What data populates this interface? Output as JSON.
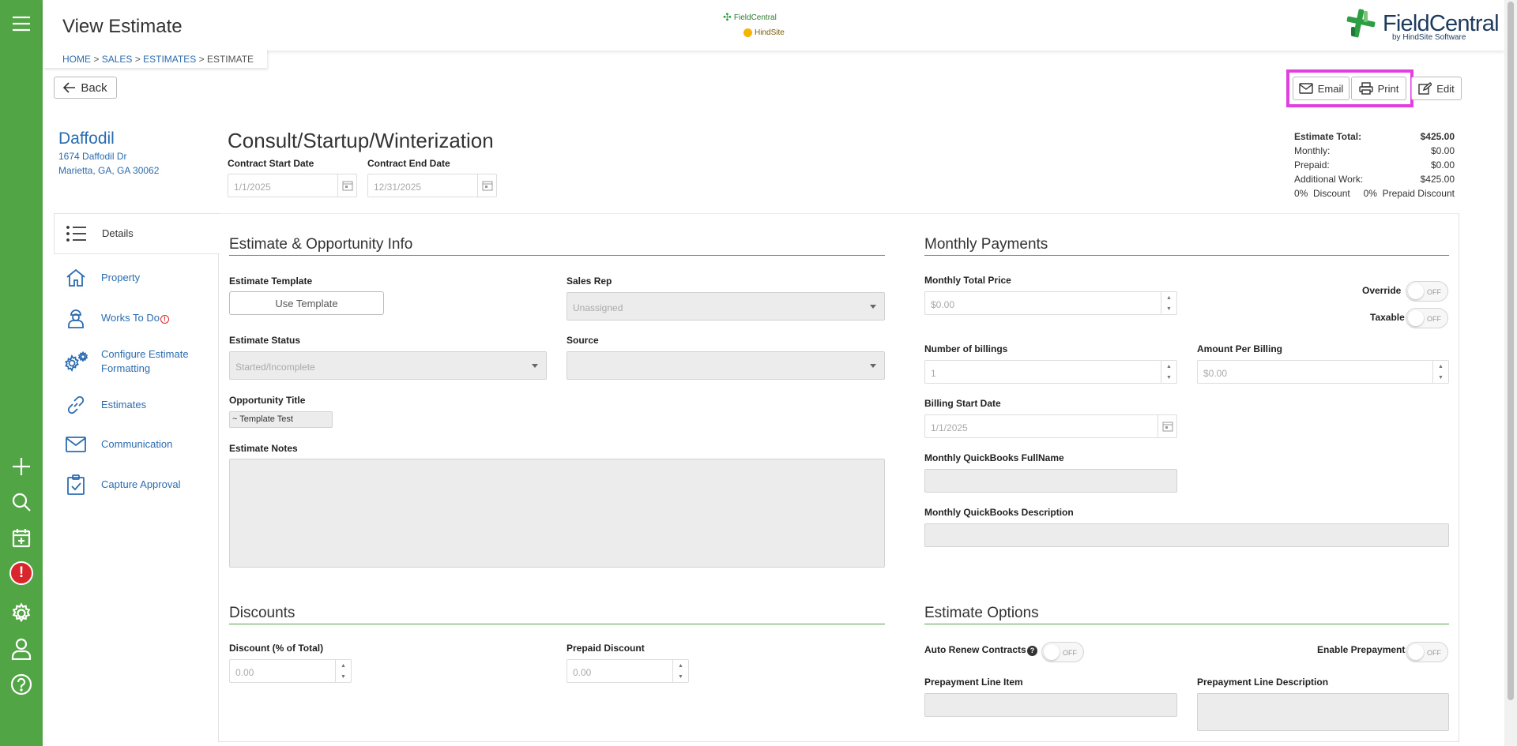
{
  "header": {
    "title": "View Estimate",
    "center_logo_top": "FieldCentral",
    "center_logo_bottom": "HindSite",
    "brand_name": "FieldCentral",
    "brand_sub": "by HindSite Software"
  },
  "breadcrumb": {
    "home": "HOME",
    "sales": "SALES",
    "estimates": "ESTIMATES",
    "current": "ESTIMATE",
    "sep": ">"
  },
  "buttons": {
    "back": "Back",
    "email": "Email",
    "print": "Print",
    "edit": "Edit",
    "use_template": "Use Template"
  },
  "customer": {
    "name": "Daffodil",
    "street": "1674 Daffodil Dr",
    "city": "Marietta, GA, GA 30062"
  },
  "estimate": {
    "name": "Consult/Startup/Winterization",
    "start_label": "Contract Start Date",
    "start_value": "1/1/2025",
    "end_label": "Contract End Date",
    "end_value": "12/31/2025"
  },
  "totals": {
    "total_label": "Estimate Total:",
    "total_value": "$425.00",
    "monthly_label": "Monthly:",
    "monthly_value": "$0.00",
    "prepaid_label": "Prepaid:",
    "prepaid_value": "$0.00",
    "additional_label": "Additional Work:",
    "additional_value": "$425.00",
    "discount_pct": "0%",
    "discount_label": "Discount",
    "prepaid_disc_pct": "0%",
    "prepaid_disc_label": "Prepaid Discount"
  },
  "tabs": [
    "Details",
    "Property",
    "Works To Do",
    "Configure Estimate Formatting",
    "Estimates",
    "Communication",
    "Capture Approval"
  ],
  "info": {
    "heading": "Estimate & Opportunity Info",
    "template_label": "Estimate Template",
    "sales_rep_label": "Sales Rep",
    "sales_rep_value": "Unassigned",
    "status_label": "Estimate Status",
    "status_value": "Started/Incomplete",
    "source_label": "Source",
    "source_value": "",
    "opp_title_label": "Opportunity Title",
    "opp_title_value": "~ Template Test",
    "notes_label": "Estimate Notes"
  },
  "monthly": {
    "heading": "Monthly Payments",
    "total_price_label": "Monthly Total Price",
    "total_price_value": "$0.00",
    "override_label": "Override",
    "taxable_label": "Taxable",
    "toggle_off": "OFF",
    "billings_label": "Number of billings",
    "billings_value": "1",
    "per_billing_label": "Amount Per Billing",
    "per_billing_value": "$0.00",
    "billing_start_label": "Billing Start Date",
    "billing_start_value": "1/1/2025",
    "qb_fullname_label": "Monthly QuickBooks FullName",
    "qb_desc_label": "Monthly QuickBooks Description"
  },
  "discounts": {
    "heading": "Discounts",
    "discount_label": "Discount (% of Total)",
    "discount_value": "0.00",
    "prepaid_label": "Prepaid Discount",
    "prepaid_value": "0.00"
  },
  "options": {
    "heading": "Estimate Options",
    "auto_renew_label": "Auto Renew Contracts",
    "enable_prepay_label": "Enable Prepayment",
    "prepay_item_label": "Prepayment Line Item",
    "prepay_desc_label": "Prepayment Line Description"
  },
  "alert_badge": "!"
}
